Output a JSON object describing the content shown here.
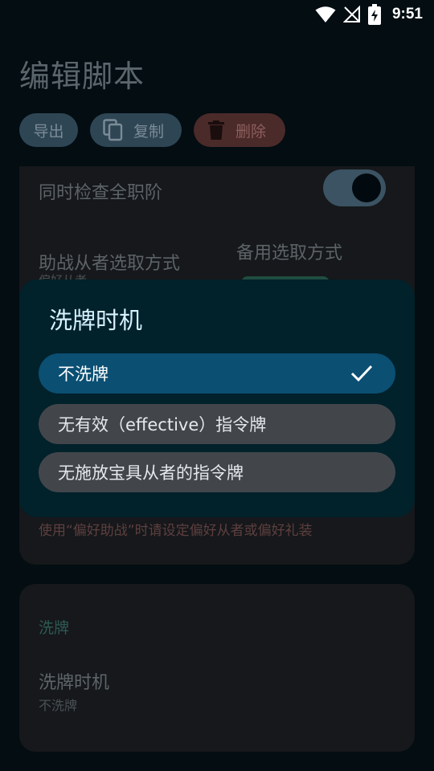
{
  "status_bar": {
    "time": "9:51",
    "icons": [
      "wifi-icon",
      "no-signal-icon",
      "battery-charging-icon"
    ]
  },
  "header": {
    "title": "编辑脚本",
    "actions": {
      "export_label": "导出",
      "copy_label": "复制",
      "delete_label": "删除"
    }
  },
  "support_card": {
    "check_all_classes_label": "同时检查全职阶",
    "check_all_classes_enabled": true,
    "support_selection_label": "助战从者选取方式",
    "support_selection_value": "偏好从者",
    "fallback_selection_label": "备用选取方式",
    "warning": "使用“偏好助战”时请设定偏好从者或偏好礼装"
  },
  "shuffle_card": {
    "section_title": "洗牌",
    "setting_title": "洗牌时机",
    "setting_value": "不洗牌"
  },
  "dialog": {
    "title": "洗牌时机",
    "options": [
      {
        "label": "不洗牌",
        "selected": true
      },
      {
        "label": "无有效（effective）指令牌",
        "selected": false
      },
      {
        "label": "无施放宝具从者的指令牌",
        "selected": false
      }
    ]
  },
  "colors": {
    "background": "#030d12",
    "dialog": "#01212b",
    "selected_option": "#0b4f73",
    "unselected_option": "#42464b",
    "delete_chip": "#4b2a2a",
    "accent_chip": "#2e4554"
  }
}
